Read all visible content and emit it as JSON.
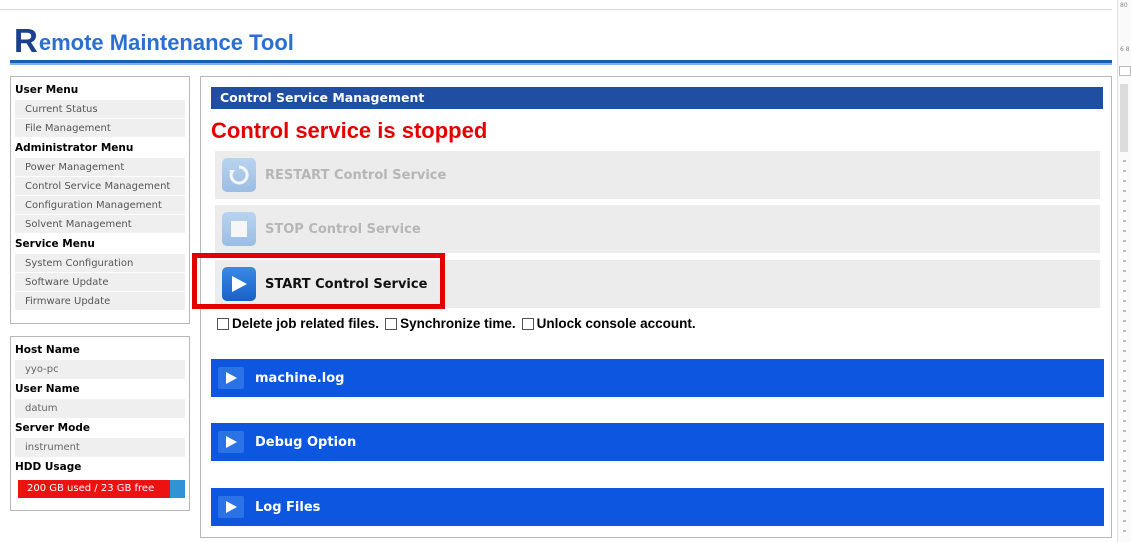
{
  "app": {
    "title_initial": "R",
    "title_rest": "emote Maintenance Tool"
  },
  "sidebar": {
    "sections": [
      {
        "title": "User Menu",
        "items": [
          "Current Status",
          "File Management"
        ]
      },
      {
        "title": "Administrator Menu",
        "items": [
          "Power Management",
          "Control Service Management",
          "Configuration Management",
          "Solvent Management"
        ]
      },
      {
        "title": "Service Menu",
        "items": [
          "System Configuration",
          "Software Update",
          "Firmware Update"
        ]
      }
    ]
  },
  "info": {
    "host_name_label": "Host Name",
    "host_name": "yyo-pc",
    "user_name_label": "User Name",
    "user_name": "datum",
    "server_mode_label": "Server Mode",
    "server_mode": "instrument",
    "hdd_label": "HDD Usage",
    "hdd_text": "200 GB used / 23 GB free",
    "hdd_used_fraction": 0.9
  },
  "main": {
    "title": "Control Service Management",
    "status": "Control service is stopped",
    "buttons": [
      {
        "label": "RESTART Control Service",
        "enabled": false,
        "icon": "restart-icon"
      },
      {
        "label": "STOP Control Service",
        "enabled": false,
        "icon": "stop-icon"
      },
      {
        "label": "START Control Service",
        "enabled": true,
        "icon": "play-icon"
      }
    ],
    "options": [
      {
        "label": "Delete job related files.",
        "checked": false
      },
      {
        "label": "Synchronize time.",
        "checked": false
      },
      {
        "label": "Unlock console account.",
        "checked": false
      }
    ],
    "sections": [
      "machine.log",
      "Debug Option",
      "Log Files"
    ]
  },
  "scroll_strip": {
    "top_text": "80",
    "mid_text": "6 8"
  },
  "colors": {
    "brand": "#1c3f8f",
    "title_bar": "#1f4ea3",
    "section_bar": "#0c56e0",
    "status": "#e40000",
    "highlight": "#e00000"
  }
}
